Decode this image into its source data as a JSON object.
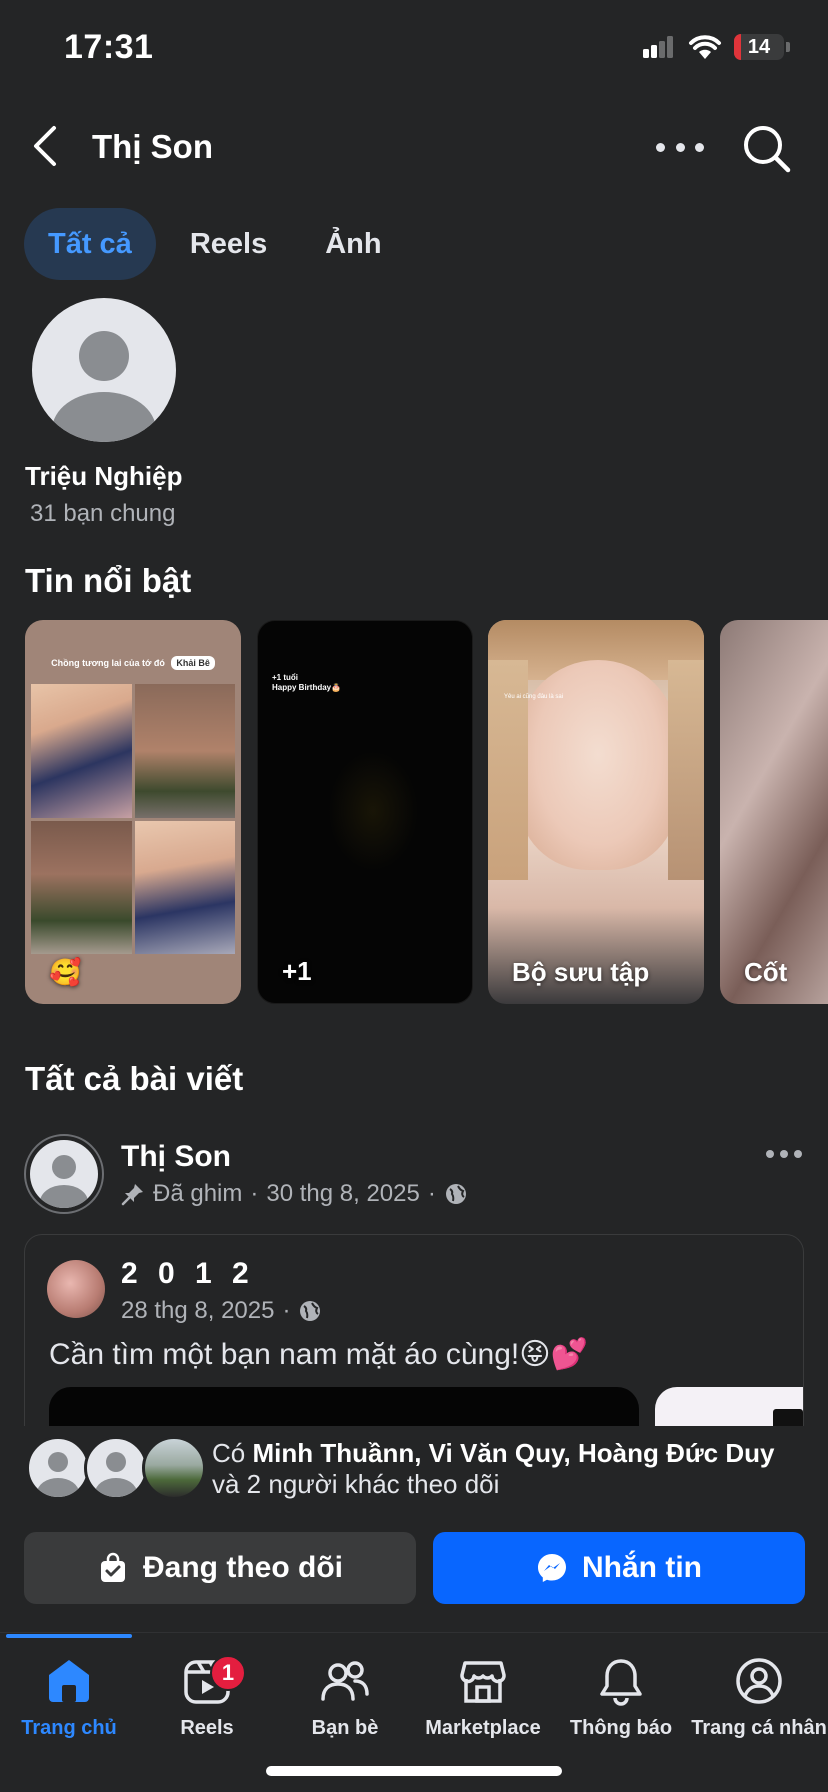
{
  "status_bar": {
    "time": "17:31",
    "battery": "14",
    "battery_level": 0.14
  },
  "header": {
    "title": "Thị Son",
    "back_icon": "chevron-left-icon",
    "more_icon": "more-horizontal-icon",
    "search_icon": "search-icon"
  },
  "tabs": [
    {
      "label": "Tất cả",
      "active": true
    },
    {
      "label": "Reels",
      "active": false
    },
    {
      "label": "Ảnh",
      "active": false
    }
  ],
  "person": {
    "name": "Triệu Nghiệp",
    "mutual": "31 bạn chung"
  },
  "highlights": {
    "title": "Tin nổi bật",
    "items": [
      {
        "label": "🥰",
        "caption": "Chồng tương lai của tớ đó",
        "tag": "Khải Bê"
      },
      {
        "label": "+1",
        "caption": "+1 tuổi\nHappy Birthday🎂"
      },
      {
        "label": "Bộ sưu tập",
        "caption": "Yêu ai cũng đâu là sai"
      },
      {
        "label": "Cốt"
      }
    ]
  },
  "posts_section": {
    "title": "Tất cả bài viết"
  },
  "post": {
    "author": "Thị Son",
    "pinned": "Đã ghim",
    "date": "30 thg 8, 2025",
    "shared": {
      "author": "2 0 1 2",
      "date": "28 thg 8, 2025",
      "text": "Cần tìm một bạn nam mặt áo cùng!😝💕"
    }
  },
  "followers": {
    "prefix": "Có ",
    "names": "Minh Thuầnn, Vi Văn Quy, Hoàng Đức Duy",
    "suffix": "và 2 người khác theo dõi"
  },
  "actions": {
    "following_label": "Đang theo dõi",
    "message_label": "Nhắn tin"
  },
  "nav": [
    {
      "label": "Trang chủ",
      "icon": "home-icon",
      "active": true
    },
    {
      "label": "Reels",
      "icon": "reels-icon",
      "badge": "1"
    },
    {
      "label": "Bạn bè",
      "icon": "friends-icon"
    },
    {
      "label": "Marketplace",
      "icon": "marketplace-icon"
    },
    {
      "label": "Thông báo",
      "icon": "bell-icon"
    },
    {
      "label": "Trang cá nhân",
      "icon": "profile-icon"
    }
  ],
  "colors": {
    "background": "#242526",
    "accent": "#0866ff",
    "nav_active": "#2d88ff",
    "tab_active_bg": "#263951",
    "badge": "#e41e3f"
  }
}
